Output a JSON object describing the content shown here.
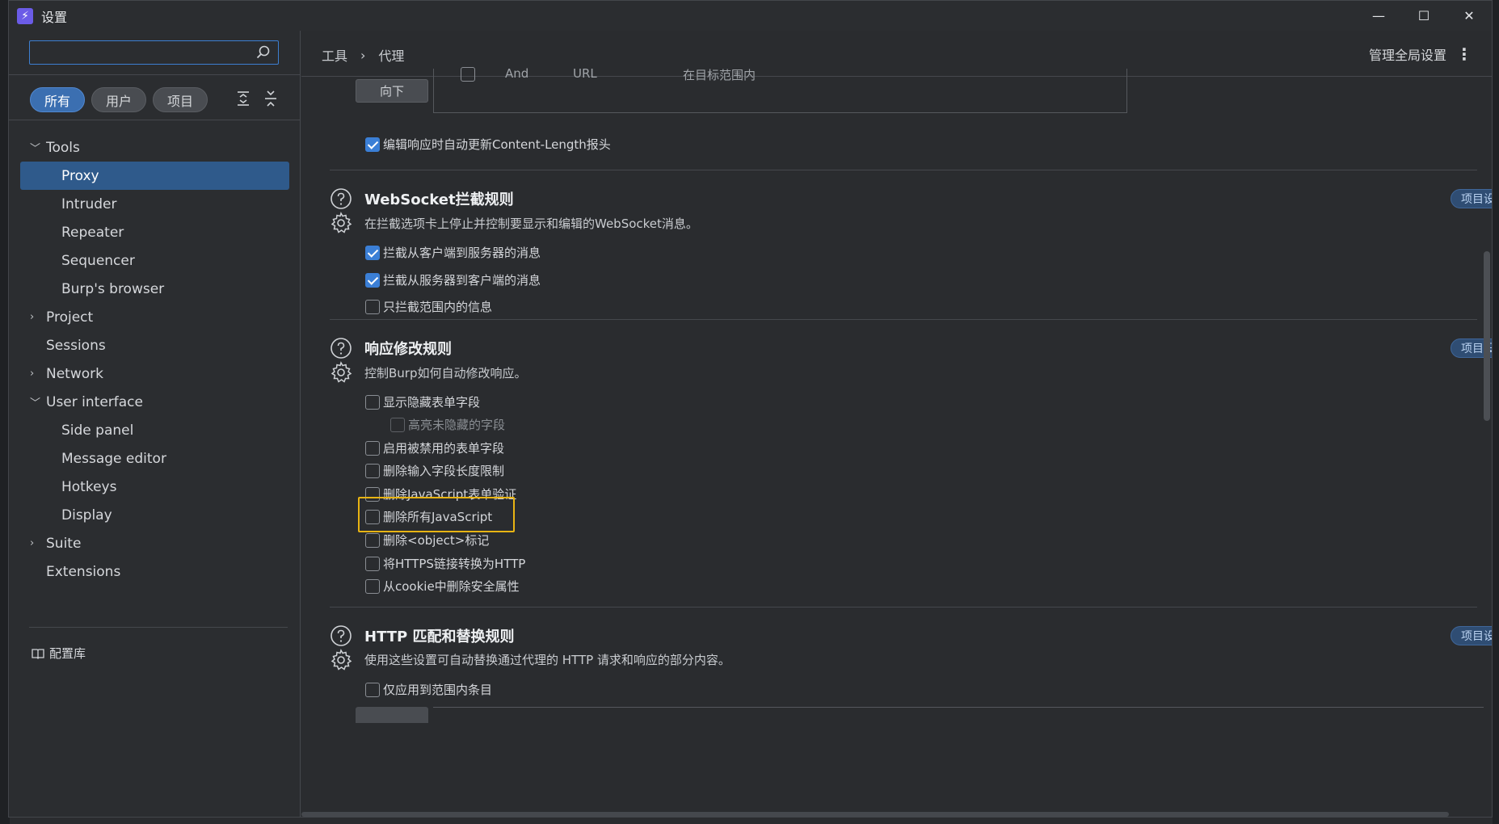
{
  "window": {
    "title": "设置"
  },
  "sidebar": {
    "search_placeholder": "",
    "filters": [
      "所有",
      "用户",
      "项目"
    ],
    "tree": [
      {
        "label": "Tools",
        "level": 0,
        "expanded": true
      },
      {
        "label": "Proxy",
        "level": 1,
        "selected": true
      },
      {
        "label": "Intruder",
        "level": 1
      },
      {
        "label": "Repeater",
        "level": 1
      },
      {
        "label": "Sequencer",
        "level": 1
      },
      {
        "label": "Burp's browser",
        "level": 1
      },
      {
        "label": "Project",
        "level": 0,
        "expanded": false
      },
      {
        "label": "Sessions",
        "level": 0
      },
      {
        "label": "Network",
        "level": 0,
        "expanded": false
      },
      {
        "label": "User interface",
        "level": 0,
        "expanded": true
      },
      {
        "label": "Side panel",
        "level": 1
      },
      {
        "label": "Message editor",
        "level": 1
      },
      {
        "label": "Hotkeys",
        "level": 1
      },
      {
        "label": "Display",
        "level": 1
      },
      {
        "label": "Suite",
        "level": 0,
        "expanded": false
      },
      {
        "label": "Extensions",
        "level": 0
      }
    ],
    "library_label": "配置库"
  },
  "header": {
    "breadcrumb": [
      "工具",
      "代理"
    ],
    "manage_label": "管理全局设置"
  },
  "top_rules": {
    "down_button": "向下",
    "row": {
      "operator": "And",
      "match_type": "URL",
      "condition": "在目标范围内"
    },
    "auto_update_content_length": {
      "label": "编辑响应时自动更新Content-Length报头",
      "checked": true
    }
  },
  "websocket": {
    "title": "WebSocket拦截规则",
    "desc": "在拦截选项卡上停止并控制要显示和编辑的WebSocket消息。",
    "badge": "项目设",
    "options": [
      {
        "label": "拦截从客户端到服务器的消息",
        "checked": true
      },
      {
        "label": "拦截从服务器到客户端的消息",
        "checked": true
      },
      {
        "label": "只拦截范围内的信息",
        "checked": false
      }
    ]
  },
  "response_mod": {
    "title": "响应修改规则",
    "desc": "控制Burp如何自动修改响应。",
    "badge": "项目设",
    "options": [
      {
        "label": "显示隐藏表单字段",
        "checked": false
      },
      {
        "label": "高亮未隐藏的字段",
        "checked": false,
        "disabled": true
      },
      {
        "label": "启用被禁用的表单字段",
        "checked": false
      },
      {
        "label": "删除输入字段长度限制",
        "checked": false
      },
      {
        "label": "删除JavaScript表单验证",
        "checked": false
      },
      {
        "label": "删除所有JavaScript",
        "checked": false,
        "highlighted": true
      },
      {
        "label": "删除<object>标记",
        "checked": false
      },
      {
        "label": "将HTTPS链接转换为HTTP",
        "checked": false
      },
      {
        "label": "从cookie中删除安全属性",
        "checked": false
      }
    ]
  },
  "http_match": {
    "title": "HTTP 匹配和替换规则",
    "desc": "使用这些设置可自动替换通过代理的 HTTP 请求和响应的部分内容。",
    "badge": "项目设",
    "options": [
      {
        "label": "仅应用到范围内条目",
        "checked": false
      }
    ]
  },
  "colors": {
    "accent": "#3b7fd6",
    "highlight": "#e8b413",
    "selected": "#2f5a8b"
  }
}
